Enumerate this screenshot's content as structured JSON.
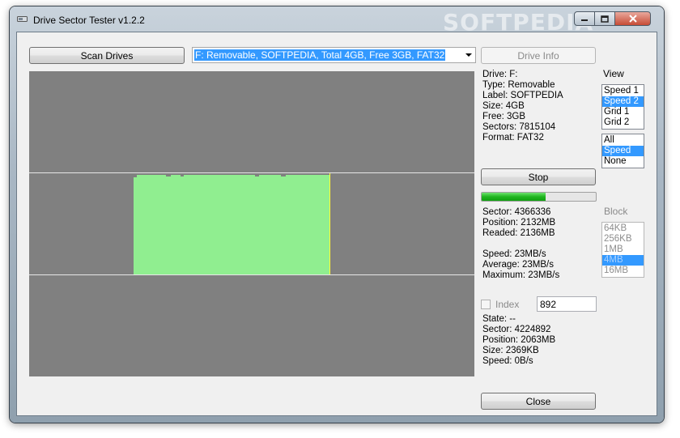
{
  "window": {
    "title": "Drive Sector Tester v1.2.2",
    "watermark": "SOFTPEDIA"
  },
  "toolbar": {
    "scan_label": "Scan Drives",
    "drive_selected": "F: Removable, SOFTPEDIA, Total 4GB, Free 3GB, FAT32",
    "drive_info_label": "Drive Info"
  },
  "drive_info": [
    "Drive: F:",
    "Type: Removable",
    "Label: SOFTPEDIA",
    "Size: 4GB",
    "Free: 3GB",
    "Sectors: 7815104",
    "Format: FAT32"
  ],
  "view": {
    "label": "View",
    "options": [
      "Speed 1",
      "Speed 2",
      "Grid 1",
      "Grid 2"
    ],
    "selected": "Speed 2",
    "filter_options": [
      "All",
      "Speed",
      "None"
    ],
    "filter_selected": "Speed"
  },
  "stop_label": "Stop",
  "progress": {
    "fraction": 0.56
  },
  "stats": [
    "Sector: 4366336",
    "Position: 2132MB",
    "Readed: 2136MB",
    "",
    "Speed: 23MB/s",
    "Average: 23MB/s",
    "Maximum: 23MB/s"
  ],
  "block": {
    "label": "Block",
    "options": [
      "64KB",
      "256KB",
      "1MB",
      "4MB",
      "16MB"
    ],
    "selected": "4MB"
  },
  "index": {
    "label": "Index",
    "value": "892",
    "checked": false
  },
  "state": [
    "State: --",
    "Sector: 4224892",
    "Position: 2063MB",
    "Size: 2369KB",
    "Speed: 0B/s"
  ],
  "close_label": "Close",
  "colors": {
    "graph_bg": "#808080",
    "graph_fill": "#90ee90",
    "cursor": "#ffff33",
    "selection": "#3399ff",
    "progress": "#1fb51f"
  }
}
